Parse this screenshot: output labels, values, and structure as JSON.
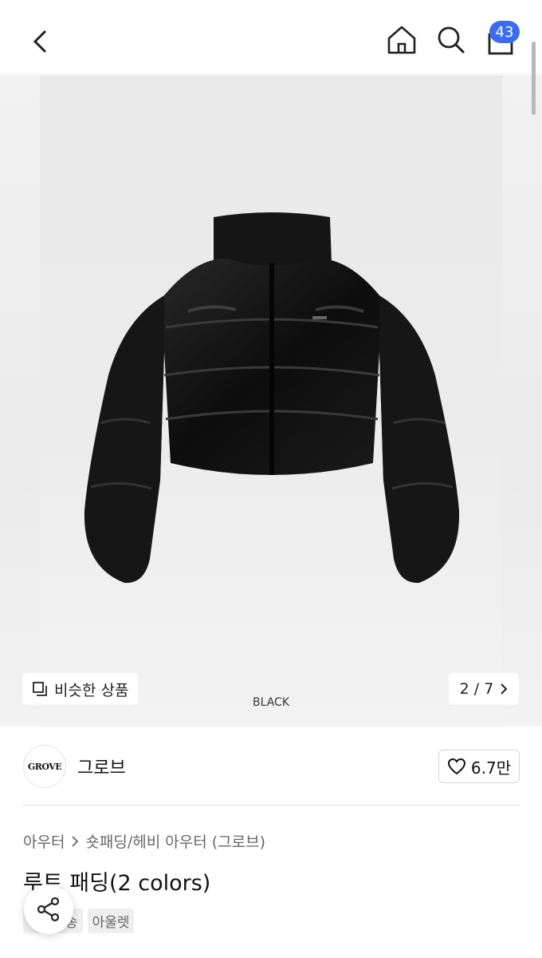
{
  "header": {
    "cart_count": "43"
  },
  "hero": {
    "similar_label": "비슷한 상품",
    "pager": "2 / 7",
    "caption": "BLACK"
  },
  "brand": {
    "logo_text": "GROVE",
    "name": "그로브",
    "likes": "6.7만"
  },
  "product": {
    "breadcrumb": [
      "아우터",
      "숏패딩/헤비 아우터 (그로브)"
    ],
    "title": "루트 패딩(2 colors)",
    "tags": [
      "무료배송",
      "아울렛"
    ]
  },
  "colors": {
    "accent": "#3b6bf0"
  }
}
